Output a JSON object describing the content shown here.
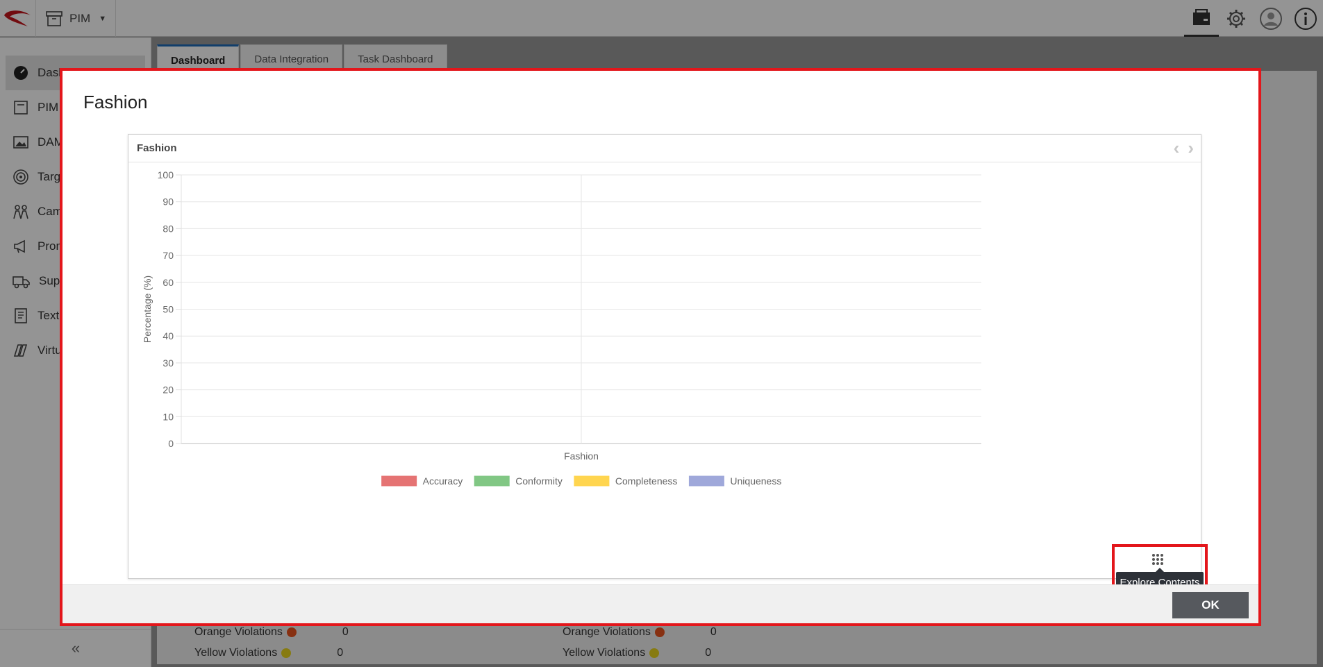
{
  "header": {
    "module_label": "PIM",
    "icons": [
      "bag-icon",
      "gear-icon",
      "user-avatar-icon",
      "info-icon"
    ]
  },
  "sidebar": {
    "items": [
      {
        "label": "Dashboard",
        "icon": "dashboard-icon"
      },
      {
        "label": "PIM",
        "icon": "pim-icon"
      },
      {
        "label": "DAM",
        "icon": "image-icon"
      },
      {
        "label": "Target",
        "icon": "target-icon"
      },
      {
        "label": "Campaign",
        "icon": "campaign-icon"
      },
      {
        "label": "Promotion",
        "icon": "megaphone-icon"
      },
      {
        "label": "Supplier",
        "icon": "truck-icon"
      },
      {
        "label": "Text",
        "icon": "document-icon"
      },
      {
        "label": "Virtual",
        "icon": "virtual-icon"
      }
    ],
    "collapse_label": "«"
  },
  "tabs": [
    {
      "label": "Dashboard"
    },
    {
      "label": "Data Integration"
    },
    {
      "label": "Task Dashboard"
    }
  ],
  "background_rows": [
    {
      "label": "Orange Violations",
      "value": "0",
      "color": "#e8541e"
    },
    {
      "label": "Yellow Violations",
      "value": "0",
      "color": "#e8d41e"
    },
    {
      "label": "Orange Violations",
      "value": "0",
      "color": "#e8541e"
    },
    {
      "label": "Yellow Violations",
      "value": "0",
      "color": "#e8d41e"
    }
  ],
  "modal": {
    "title": "Fashion",
    "card_title": "Fashion",
    "tooltip": "Explore Contents",
    "ok_label": "OK"
  },
  "chart_data": {
    "type": "bar",
    "categories": [
      "Fashion"
    ],
    "series": [
      {
        "name": "Accuracy",
        "values": [
          0
        ],
        "color": "#e57373"
      },
      {
        "name": "Conformity",
        "values": [
          0
        ],
        "color": "#81c784"
      },
      {
        "name": "Completeness",
        "values": [
          0
        ],
        "color": "#ffd54f"
      },
      {
        "name": "Uniqueness",
        "values": [
          0
        ],
        "color": "#9fa8da"
      }
    ],
    "ylabel": "Percentage (%)",
    "xlabel": "",
    "ylim": [
      0,
      100
    ],
    "yticks": [
      0,
      10,
      20,
      30,
      40,
      50,
      60,
      70,
      80,
      90,
      100
    ],
    "grid": true,
    "legend": "bottom"
  }
}
